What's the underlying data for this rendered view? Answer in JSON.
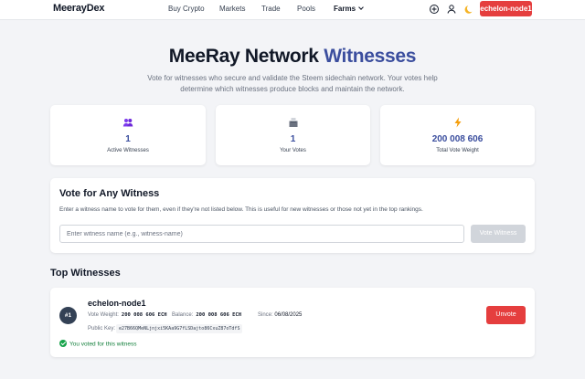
{
  "header": {
    "brand": "MeerayDex",
    "nav": [
      "Buy Crypto",
      "Markets",
      "Trade",
      "Pools",
      "Farms"
    ],
    "icons": [
      "plus-circle-icon",
      "user-icon",
      "moon-icon"
    ],
    "account": "echelon-node1"
  },
  "hero": {
    "title": "MeeRay Network",
    "title_accent": "Witnesses",
    "subtitle": "Vote for witnesses who secure and validate the Steem sidechain network. Your votes help determine which witnesses produce blocks and maintain the network."
  },
  "stats": [
    {
      "icon": "users-icon",
      "value": "1",
      "label": "Active Witnesses"
    },
    {
      "icon": "ballot-box-icon",
      "value": "1",
      "label": "Your Votes"
    },
    {
      "icon": "lightning-icon",
      "value": "200 008 606",
      "label": "Total Vote Weight"
    }
  ],
  "vote": {
    "title": "Vote for Any Witness",
    "description": "Enter a witness name to vote for them, even if they're not listed below. This is useful for new witnesses or those not yet in the top rankings.",
    "placeholder": "Enter witness name (e.g., witness-name)",
    "button": "Vote Witness"
  },
  "top": {
    "title": "Top Witnesses",
    "witnesses": [
      {
        "rank": "#1",
        "name": "echelon-node1",
        "vote_weight_label": "Vote Weight:",
        "vote_weight": "200 008 606 ECH",
        "balance_label": "Balance:",
        "balance": "200 008 606 ECH",
        "since_label": "Since:",
        "since": "06/08/2025",
        "key_label": "Public Key:",
        "public_key": "e27B66QMeNLjnjxi5KAa9G7fLSDajto86CxuZ87oTdfS",
        "voted_text": "You voted for this witness",
        "unvote": "Unvote"
      }
    ]
  },
  "colors": {
    "accent": "#3b4e9e",
    "danger": "#e53e3e",
    "success": "#16a34a",
    "background": "#f3f4f7"
  }
}
